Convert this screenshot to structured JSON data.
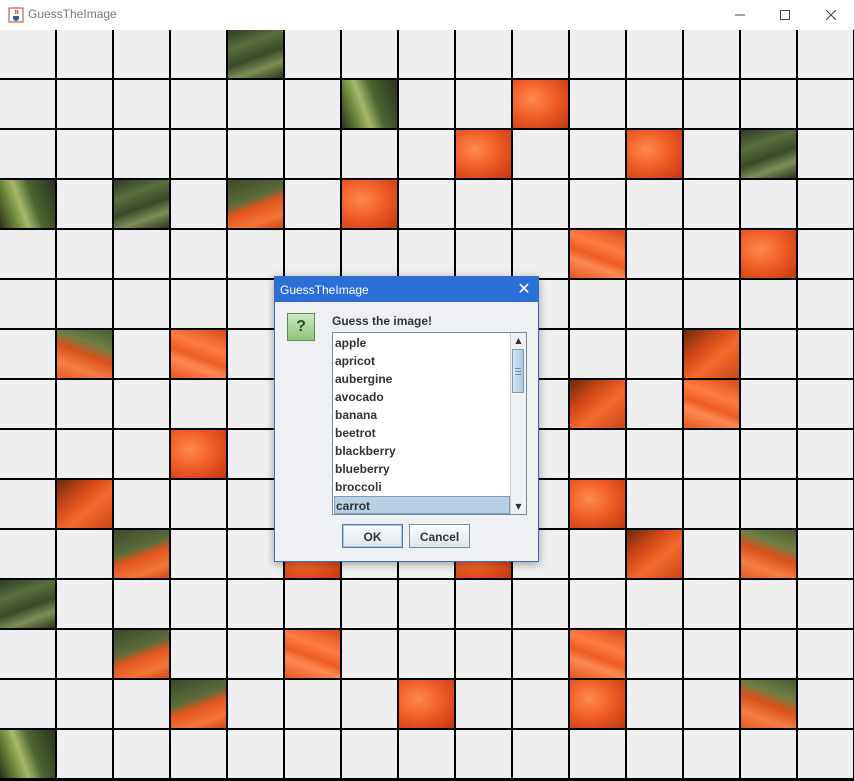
{
  "window": {
    "title": "GuessTheImage",
    "icon": "java-cup-icon",
    "controls": [
      "minimize",
      "maximize",
      "close"
    ]
  },
  "grid": {
    "columns": 15,
    "rows": 15,
    "revealed_tiles": [
      {
        "col": 4,
        "row": 0,
        "kind": "greens"
      },
      {
        "col": 6,
        "row": 1,
        "kind": "greens2"
      },
      {
        "col": 9,
        "row": 1,
        "kind": "carrot"
      },
      {
        "col": 8,
        "row": 2,
        "kind": "carrot"
      },
      {
        "col": 11,
        "row": 2,
        "kind": "carrot"
      },
      {
        "col": 13,
        "row": 2,
        "kind": "greens"
      },
      {
        "col": 0,
        "row": 3,
        "kind": "greens2"
      },
      {
        "col": 2,
        "row": 3,
        "kind": "greens"
      },
      {
        "col": 4,
        "row": 3,
        "kind": "mix"
      },
      {
        "col": 6,
        "row": 3,
        "kind": "carrot"
      },
      {
        "col": 10,
        "row": 4,
        "kind": "carrot-stripe"
      },
      {
        "col": 13,
        "row": 4,
        "kind": "carrot"
      },
      {
        "col": 1,
        "row": 6,
        "kind": "mix2"
      },
      {
        "col": 3,
        "row": 6,
        "kind": "carrot-stripe"
      },
      {
        "col": 12,
        "row": 6,
        "kind": "carrot-dark"
      },
      {
        "col": 10,
        "row": 7,
        "kind": "carrot-dark"
      },
      {
        "col": 12,
        "row": 7,
        "kind": "carrot-stripe"
      },
      {
        "col": 3,
        "row": 8,
        "kind": "carrot"
      },
      {
        "col": 1,
        "row": 9,
        "kind": "carrot-dark"
      },
      {
        "col": 10,
        "row": 9,
        "kind": "carrot"
      },
      {
        "col": 2,
        "row": 10,
        "kind": "mix"
      },
      {
        "col": 5,
        "row": 10,
        "kind": "carrot"
      },
      {
        "col": 8,
        "row": 10,
        "kind": "carrot"
      },
      {
        "col": 11,
        "row": 10,
        "kind": "carrot-dark"
      },
      {
        "col": 13,
        "row": 10,
        "kind": "mix2"
      },
      {
        "col": 0,
        "row": 11,
        "kind": "greens"
      },
      {
        "col": 2,
        "row": 12,
        "kind": "mix"
      },
      {
        "col": 5,
        "row": 12,
        "kind": "carrot-stripe"
      },
      {
        "col": 10,
        "row": 12,
        "kind": "carrot-stripe"
      },
      {
        "col": 3,
        "row": 13,
        "kind": "mix"
      },
      {
        "col": 7,
        "row": 13,
        "kind": "carrot"
      },
      {
        "col": 10,
        "row": 13,
        "kind": "carrot"
      },
      {
        "col": 13,
        "row": 13,
        "kind": "mix2"
      },
      {
        "col": 0,
        "row": 14,
        "kind": "greens2"
      }
    ]
  },
  "dialog": {
    "title": "GuessTheImage",
    "icon": "question-icon",
    "icon_glyph": "?",
    "prompt": "Guess the image!",
    "options": [
      "apple",
      "apricot",
      "aubergine",
      "avocado",
      "banana",
      "beetrot",
      "blackberry",
      "blueberry",
      "broccoli",
      "carrot"
    ],
    "selected": "carrot",
    "ok_label": "OK",
    "cancel_label": "Cancel"
  }
}
